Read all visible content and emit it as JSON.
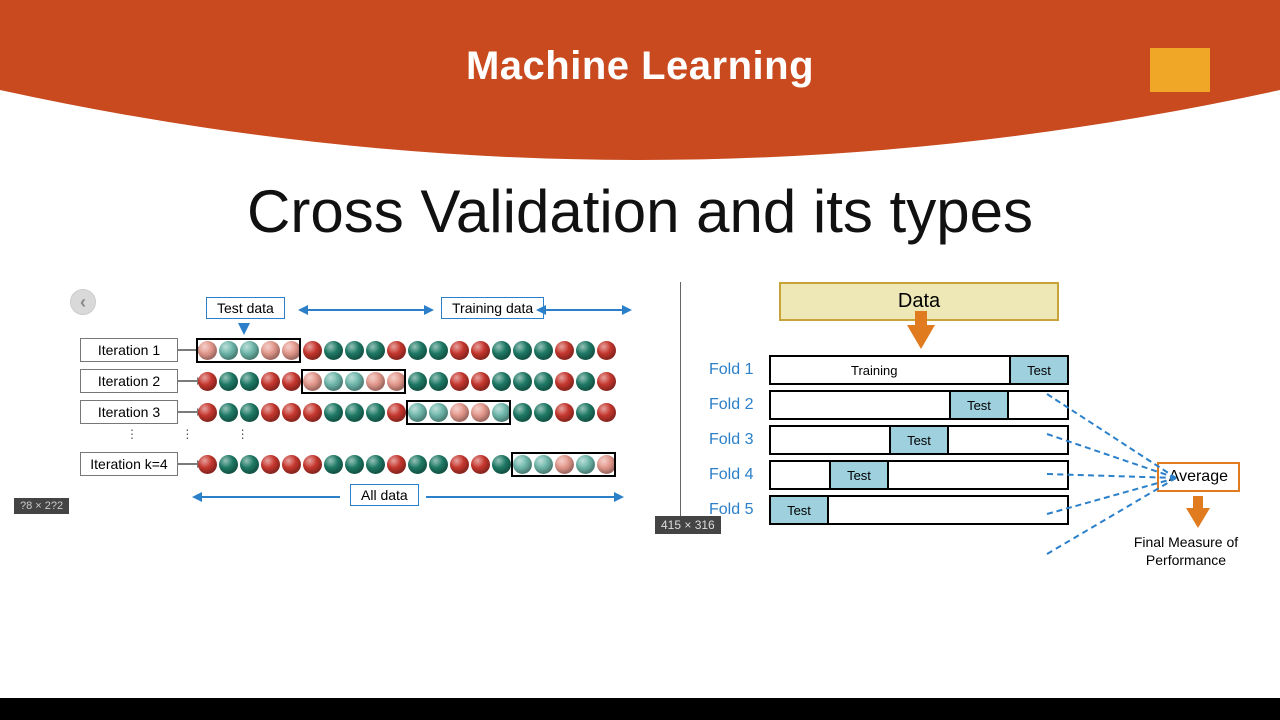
{
  "header": {
    "title": "Machine Learning"
  },
  "subtitle": "Cross Validation and its types",
  "colors": {
    "banner": "#c84a1e",
    "gold": "#f0a626",
    "blue": "#2b80c9",
    "bead_red": "#c7372e",
    "bead_green": "#1e7a66",
    "bead_pink": "#e5998d",
    "bead_teal": "#6fb8ac",
    "test_fill": "#9fd0de",
    "avg_border": "#e07b1f"
  },
  "left": {
    "labels": {
      "test_data": "Test data",
      "training_data": "Training data",
      "all_data": "All data"
    },
    "iterations": [
      {
        "name": "Iteration 1",
        "selected_range": [
          0,
          5
        ],
        "beads": [
          "pink",
          "teal",
          "teal",
          "pink",
          "pink",
          "red",
          "green",
          "green",
          "green",
          "red",
          "green",
          "green",
          "red",
          "red",
          "green",
          "green",
          "green",
          "red",
          "green",
          "red"
        ]
      },
      {
        "name": "Iteration 2",
        "selected_range": [
          5,
          10
        ],
        "beads": [
          "red",
          "green",
          "green",
          "red",
          "red",
          "pink",
          "teal",
          "teal",
          "pink",
          "pink",
          "green",
          "green",
          "red",
          "red",
          "green",
          "green",
          "green",
          "red",
          "green",
          "red"
        ]
      },
      {
        "name": "Iteration 3",
        "selected_range": [
          10,
          15
        ],
        "beads": [
          "red",
          "green",
          "green",
          "red",
          "red",
          "red",
          "green",
          "green",
          "green",
          "red",
          "teal",
          "teal",
          "pink",
          "pink",
          "teal",
          "green",
          "green",
          "red",
          "green",
          "red"
        ]
      },
      {
        "name": "Iteration k=4",
        "selected_range": [
          15,
          20
        ],
        "beads": [
          "red",
          "green",
          "green",
          "red",
          "red",
          "red",
          "green",
          "green",
          "green",
          "red",
          "green",
          "green",
          "red",
          "red",
          "green",
          "teal",
          "teal",
          "pink",
          "teal",
          "pink"
        ]
      }
    ],
    "dimension_tag": "?8 × 2?2"
  },
  "right": {
    "data_label": "Data",
    "training_label": "Training",
    "test_label": "Test",
    "average_label": "Average",
    "final_label": "Final Measure of Performance",
    "dimension_tag": "415 × 316",
    "folds": [
      {
        "label": "Fold 1",
        "test_left_pct": 80,
        "test_width_pct": 20,
        "show_training": true
      },
      {
        "label": "Fold 2",
        "test_left_pct": 60,
        "test_width_pct": 20,
        "show_training": false
      },
      {
        "label": "Fold 3",
        "test_left_pct": 40,
        "test_width_pct": 20,
        "show_training": false
      },
      {
        "label": "Fold 4",
        "test_left_pct": 20,
        "test_width_pct": 20,
        "show_training": false
      },
      {
        "label": "Fold 5",
        "test_left_pct": 0,
        "test_width_pct": 20,
        "show_training": false
      }
    ]
  }
}
